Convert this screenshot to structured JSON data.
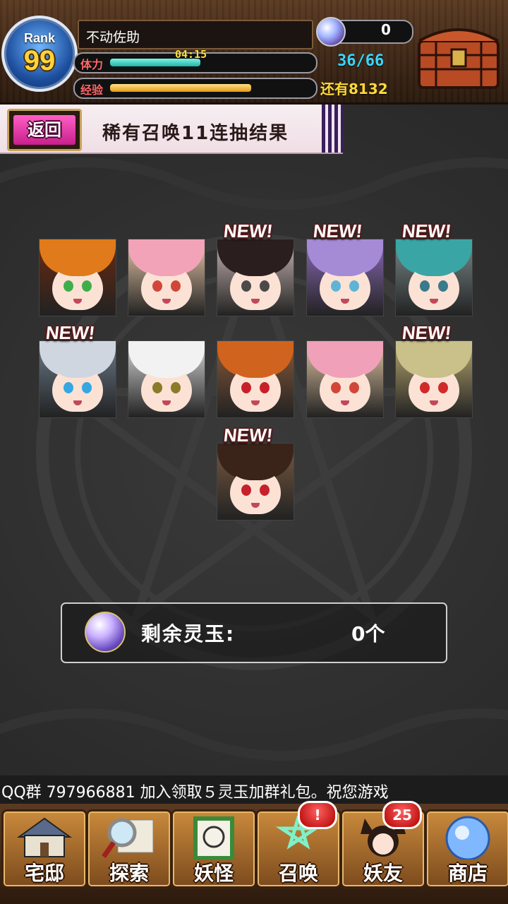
{
  "header": {
    "rank_label": "Rank",
    "rank_value": "99",
    "player_name": "不动佐助",
    "stamina_label": "体力",
    "stamina_timer": "04:15",
    "stamina_fill": 0.45,
    "stamina_count": "36/66",
    "exp_label": "经验",
    "exp_fill": 0.7,
    "exp_remaining": "还有8132",
    "orb_count": "0"
  },
  "banner": {
    "back_label": "返回",
    "title": "稀有召唤11连抽结果"
  },
  "cards": [
    {
      "is_new": false,
      "hair": "#e07a1a",
      "eye": "#3fae4a",
      "bg": "#6a2a10"
    },
    {
      "is_new": false,
      "hair": "#f2a3b8",
      "eye": "#d0473a",
      "bg": "#e8c9a8"
    },
    {
      "is_new": true,
      "hair": "#2a1e1e",
      "eye": "#4a4a4a",
      "bg": "#c9b7b5"
    },
    {
      "is_new": true,
      "hair": "#a58ad6",
      "eye": "#5fb4d6",
      "bg": "#8b6bb8"
    },
    {
      "is_new": true,
      "hair": "#3aa5a5",
      "eye": "#3a7a8a",
      "bg": "#7a8a8a"
    },
    {
      "is_new": true,
      "hair": "#d0d6e0",
      "eye": "#36a7e2",
      "bg": "#6a7a8a"
    },
    {
      "is_new": false,
      "hair": "#f2f2f2",
      "eye": "#8a7a2a",
      "bg": "#d8d8d8"
    },
    {
      "is_new": false,
      "hair": "#d0641e",
      "eye": "#c8202a",
      "bg": "#8a5a3a"
    },
    {
      "is_new": false,
      "hair": "#f0a0b8",
      "eye": "#d0473a",
      "bg": "#e4c7a5"
    },
    {
      "is_new": true,
      "hair": "#c9c08a",
      "eye": "#d02a2a",
      "bg": "#b8a870"
    },
    {
      "is_new": true,
      "hair": "#3a241a",
      "eye": "#c8202a",
      "bg": "#7a5a40"
    }
  ],
  "new_label": "NEW!",
  "spirit": {
    "label": "剩余灵玉:",
    "value": "0个"
  },
  "ticker": "QQ群 797966881   加入领取５灵玉加群礼包。祝您游戏",
  "nav": [
    {
      "label": "宅邸",
      "icon": "house-icon"
    },
    {
      "label": "探索",
      "icon": "magnifier-map-icon"
    },
    {
      "label": "妖怪",
      "icon": "scroll-icon"
    },
    {
      "label": "召唤",
      "icon": "pentagram-icon",
      "badge": "!"
    },
    {
      "label": "妖友",
      "icon": "fox-girl-icon",
      "badge": "25"
    },
    {
      "label": "商店",
      "icon": "orb-icon"
    }
  ]
}
